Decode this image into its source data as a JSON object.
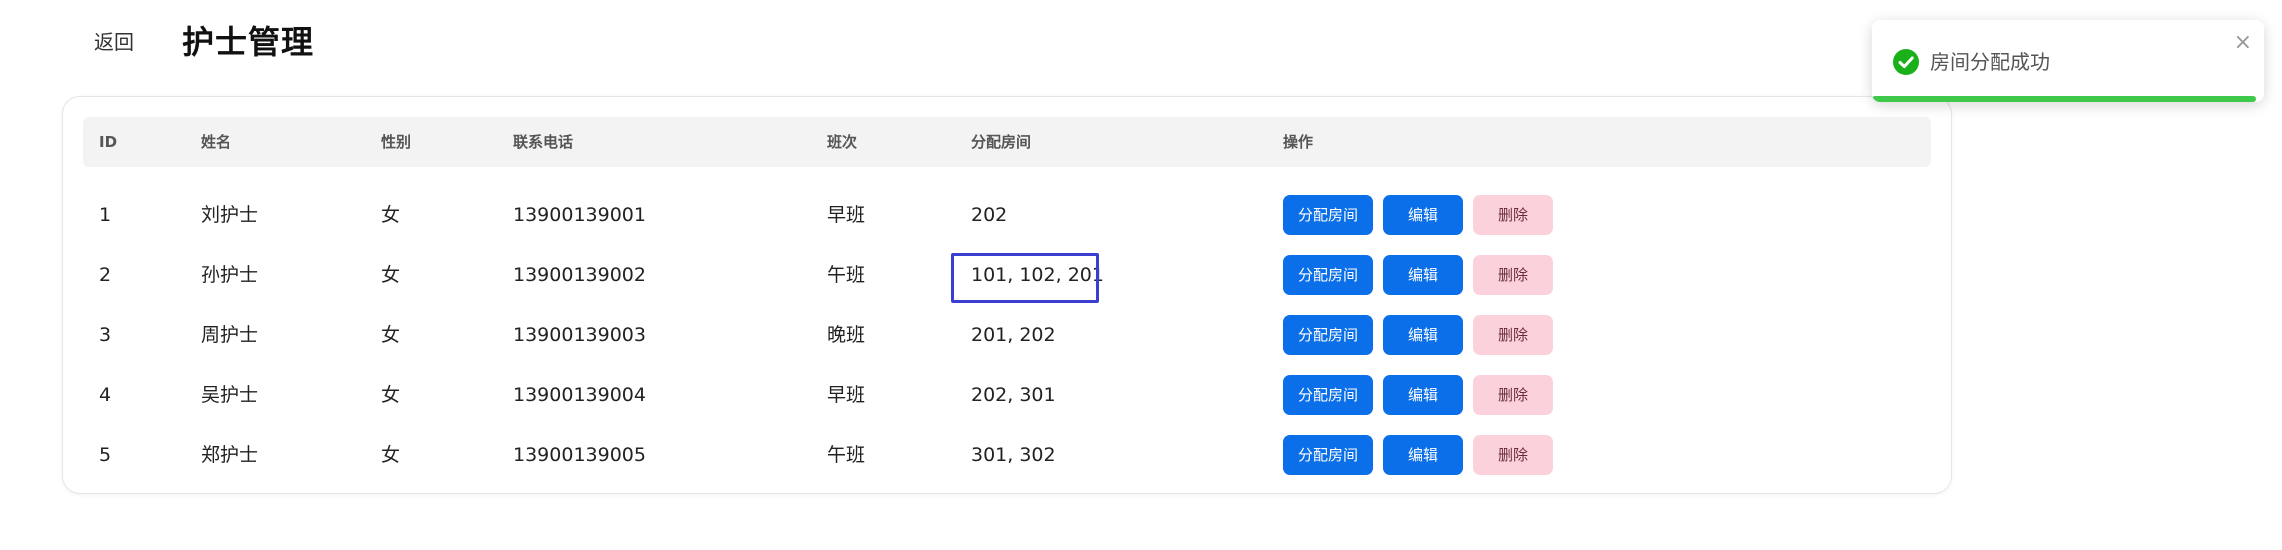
{
  "header": {
    "back_label": "返回",
    "title": "护士管理"
  },
  "table": {
    "columns": {
      "id": "ID",
      "name": "姓名",
      "gender": "性别",
      "phone": "联系电话",
      "shift": "班次",
      "rooms": "分配房间",
      "actions": "操作"
    },
    "rows": [
      {
        "id": "1",
        "name": "刘护士",
        "gender": "女",
        "phone": "13900139001",
        "shift": "早班",
        "rooms": "202"
      },
      {
        "id": "2",
        "name": "孙护士",
        "gender": "女",
        "phone": "13900139002",
        "shift": "午班",
        "rooms": "101, 102, 201"
      },
      {
        "id": "3",
        "name": "周护士",
        "gender": "女",
        "phone": "13900139003",
        "shift": "晚班",
        "rooms": "201, 202"
      },
      {
        "id": "4",
        "name": "吴护士",
        "gender": "女",
        "phone": "13900139004",
        "shift": "早班",
        "rooms": "202, 301"
      },
      {
        "id": "5",
        "name": "郑护士",
        "gender": "女",
        "phone": "13900139005",
        "shift": "午班",
        "rooms": "301, 302"
      }
    ],
    "highlighted_row": 1,
    "actions": {
      "assign_label": "分配房间",
      "edit_label": "编辑",
      "delete_label": "删除"
    }
  },
  "toast": {
    "message": "房间分配成功",
    "close_symbol": "×",
    "icon": "check-circle-icon",
    "progress": 0.98,
    "color": "#3ec94a"
  },
  "colors": {
    "primary": "#0a6fe8",
    "danger_soft": "#fbd2dc",
    "highlight": "#3b3fd1",
    "success": "#3ec94a"
  }
}
